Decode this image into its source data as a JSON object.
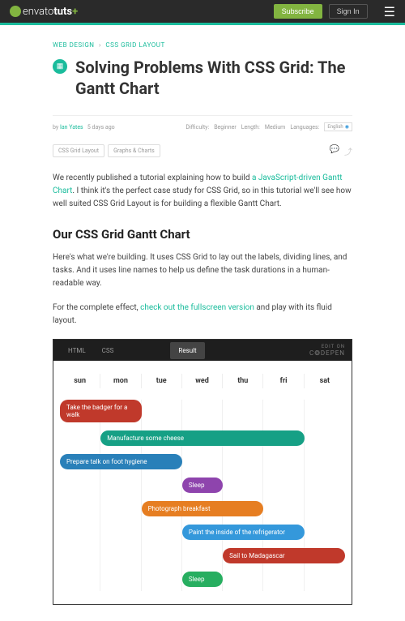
{
  "header": {
    "logo_brand": "envato",
    "logo_product": "tuts",
    "subscribe": "Subscribe",
    "signin": "Sign In"
  },
  "breadcrumb": {
    "cat1": "WEB DESIGN",
    "cat2": "CSS GRID LAYOUT"
  },
  "article": {
    "title": "Solving Problems With CSS Grid: The Gantt Chart",
    "author_prefix": "by",
    "author": "Ian Yates",
    "date": "5 days ago",
    "difficulty_label": "Difficulty:",
    "difficulty": "Beginner",
    "length_label": "Length:",
    "length": "Medium",
    "languages_label": "Languages:",
    "language": "English",
    "tags": [
      "CSS Grid Layout",
      "Graphs & Charts"
    ],
    "p1_a": "We recently published a tutorial explaining how to build ",
    "p1_link": "a JavaScript-driven Gantt Chart",
    "p1_b": ". I think it's the perfect case study for CSS Grid, so in this tutorial we'll see how well suited CSS Grid Layout is for building a flexible Gantt Chart.",
    "h2": "Our CSS Grid Gantt Chart",
    "p2": "Here's what we're building. It uses CSS Grid to lay out the labels, dividing lines, and tasks. And it uses line names to help us define the task durations in a human-readable way.",
    "p3_a": "For the complete effect, ",
    "p3_link": "check out the fullscreen version",
    "p3_b": " and play with its fluid layout."
  },
  "codepen": {
    "tab_html": "HTML",
    "tab_css": "CSS",
    "tab_result": "Result",
    "edit_label": "EDIT ON",
    "brand": "C❂DEPEN"
  },
  "gantt": {
    "days": [
      "sun",
      "mon",
      "tue",
      "wed",
      "thu",
      "fri",
      "sat"
    ],
    "tasks": [
      {
        "label": "Take the badger for a walk",
        "start": 1,
        "span": 2,
        "color": "#c0392b"
      },
      {
        "label": "Manufacture some cheese",
        "start": 2,
        "span": 5,
        "color": "#16a085"
      },
      {
        "label": "Prepare talk on foot hygiene",
        "start": 1,
        "span": 3,
        "color": "#2980b9"
      },
      {
        "label": "Sleep",
        "start": 4,
        "span": 1,
        "color": "#8e44ad"
      },
      {
        "label": "Photograph breakfast",
        "start": 3,
        "span": 3,
        "color": "#e67e22"
      },
      {
        "label": "Paint the inside of the refrigerator",
        "start": 4,
        "span": 3,
        "color": "#3498db"
      },
      {
        "label": "Sail to Madagascar",
        "start": 5,
        "span": 3,
        "color": "#c0392b"
      },
      {
        "label": "Sleep",
        "start": 4,
        "span": 1,
        "color": "#27ae60"
      }
    ]
  },
  "chart_data": {
    "type": "gantt",
    "categories": [
      "sun",
      "mon",
      "tue",
      "wed",
      "thu",
      "fri",
      "sat"
    ],
    "series": [
      {
        "name": "Take the badger for a walk",
        "start": "sun",
        "end": "mon"
      },
      {
        "name": "Manufacture some cheese",
        "start": "mon",
        "end": "fri"
      },
      {
        "name": "Prepare talk on foot hygiene",
        "start": "sun",
        "end": "tue"
      },
      {
        "name": "Sleep",
        "start": "wed",
        "end": "wed"
      },
      {
        "name": "Photograph breakfast",
        "start": "tue",
        "end": "thu"
      },
      {
        "name": "Paint the inside of the refrigerator",
        "start": "wed",
        "end": "fri"
      },
      {
        "name": "Sail to Madagascar",
        "start": "thu",
        "end": "sat"
      },
      {
        "name": "Sleep",
        "start": "wed",
        "end": "wed"
      }
    ]
  }
}
